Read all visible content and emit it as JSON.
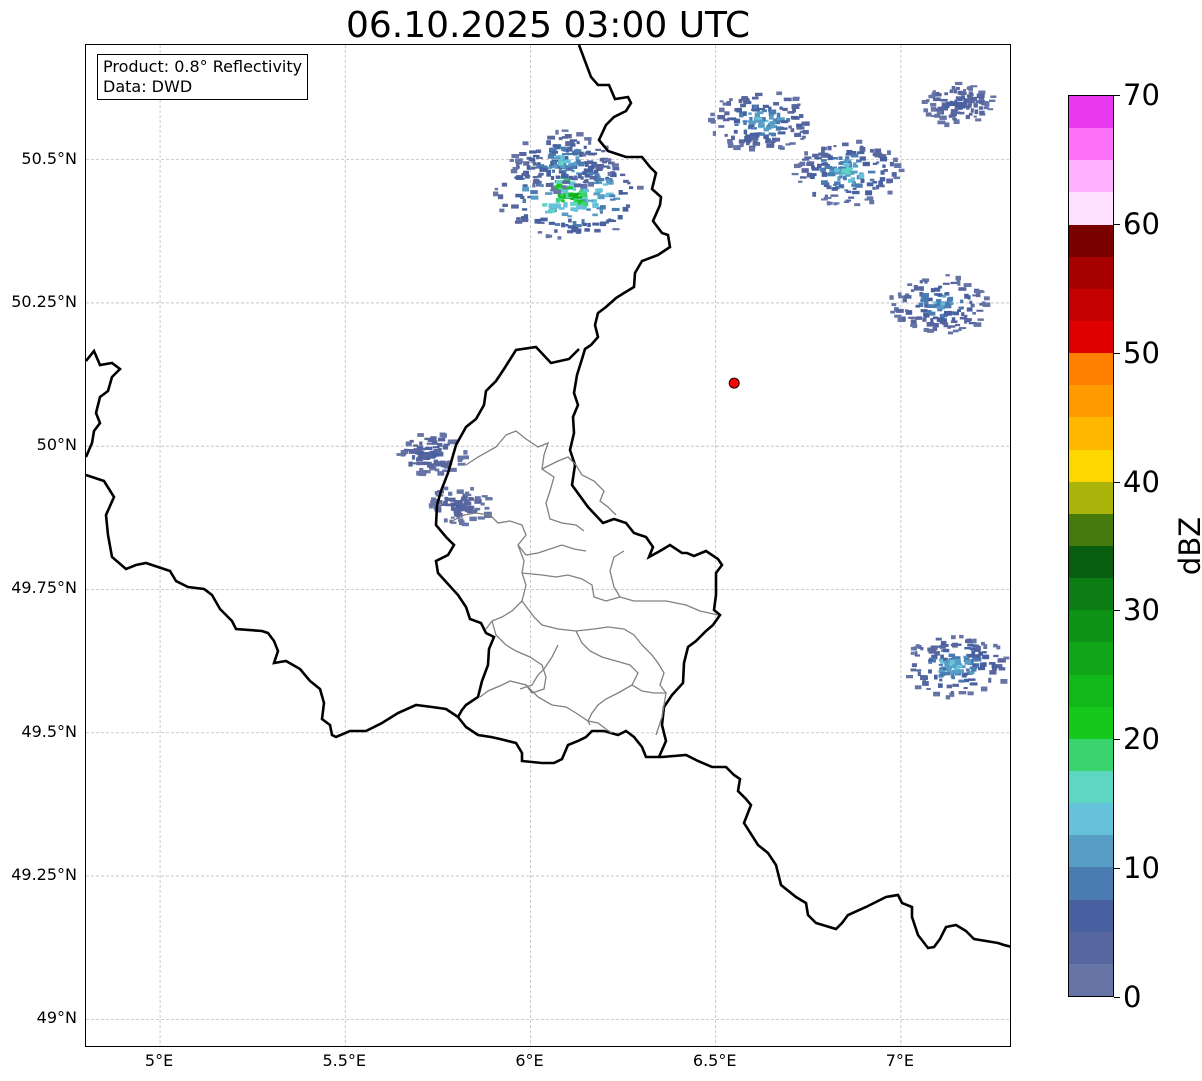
{
  "title": "06.10.2025 03:00 UTC",
  "info_box": {
    "product": "Product: 0.8° Reflectivity",
    "data": "Data: DWD"
  },
  "map": {
    "lon_range": [
      4.8,
      7.3
    ],
    "lat_range": [
      48.95,
      50.7
    ],
    "gridlines": true,
    "lat_ticks": [
      {
        "value": 50.5,
        "label": "50.5°N"
      },
      {
        "value": 50.25,
        "label": "50.25°N"
      },
      {
        "value": 50.0,
        "label": "50°N"
      },
      {
        "value": 49.75,
        "label": "49.75°N"
      },
      {
        "value": 49.5,
        "label": "49.5°N"
      },
      {
        "value": 49.25,
        "label": "49.25°N"
      },
      {
        "value": 49.0,
        "label": "49°N"
      }
    ],
    "lon_ticks": [
      {
        "value": 5.0,
        "label": "5°E"
      },
      {
        "value": 5.5,
        "label": "5.5°E"
      },
      {
        "value": 6.0,
        "label": "6°E"
      },
      {
        "value": 6.5,
        "label": "6.5°E"
      },
      {
        "value": 7.0,
        "label": "7°E"
      }
    ],
    "radar_site": {
      "lon": 6.55,
      "lat": 50.11,
      "color": "#ff0000"
    },
    "echo_areas": [
      {
        "lon": 6.1,
        "lat": 50.44,
        "max_dbz": 28
      },
      {
        "lon": 6.08,
        "lat": 50.5,
        "max_dbz": 16
      },
      {
        "lon": 6.62,
        "lat": 50.57,
        "max_dbz": 16
      },
      {
        "lon": 6.85,
        "lat": 50.48,
        "max_dbz": 18
      },
      {
        "lon": 7.15,
        "lat": 50.6,
        "max_dbz": 8
      },
      {
        "lon": 7.1,
        "lat": 50.25,
        "max_dbz": 15
      },
      {
        "lon": 5.72,
        "lat": 49.99,
        "max_dbz": 8
      },
      {
        "lon": 5.8,
        "lat": 49.9,
        "max_dbz": 6
      },
      {
        "lon": 7.14,
        "lat": 49.62,
        "max_dbz": 17
      }
    ]
  },
  "colorbar": {
    "label": "dBZ",
    "min": 0,
    "max": 70,
    "ticks": [
      "0",
      "10",
      "20",
      "30",
      "40",
      "50",
      "60",
      "70"
    ],
    "colors": [
      "#6674a6",
      "#5866a0",
      "#4660a0",
      "#4a7bb1",
      "#589dc6",
      "#66c2db",
      "#5fd6c2",
      "#3ad46e",
      "#14c81c",
      "#12b81a",
      "#10a618",
      "#0e9316",
      "#0b7d13",
      "#075e0f",
      "#477a0d",
      "#aab40a",
      "#ffd700",
      "#ffb700",
      "#ff9a00",
      "#ff7f00",
      "#e00000",
      "#c40000",
      "#a60000",
      "#7a0000",
      "#ffe0ff",
      "#ffb0ff",
      "#ff70f8",
      "#e838f0"
    ]
  }
}
